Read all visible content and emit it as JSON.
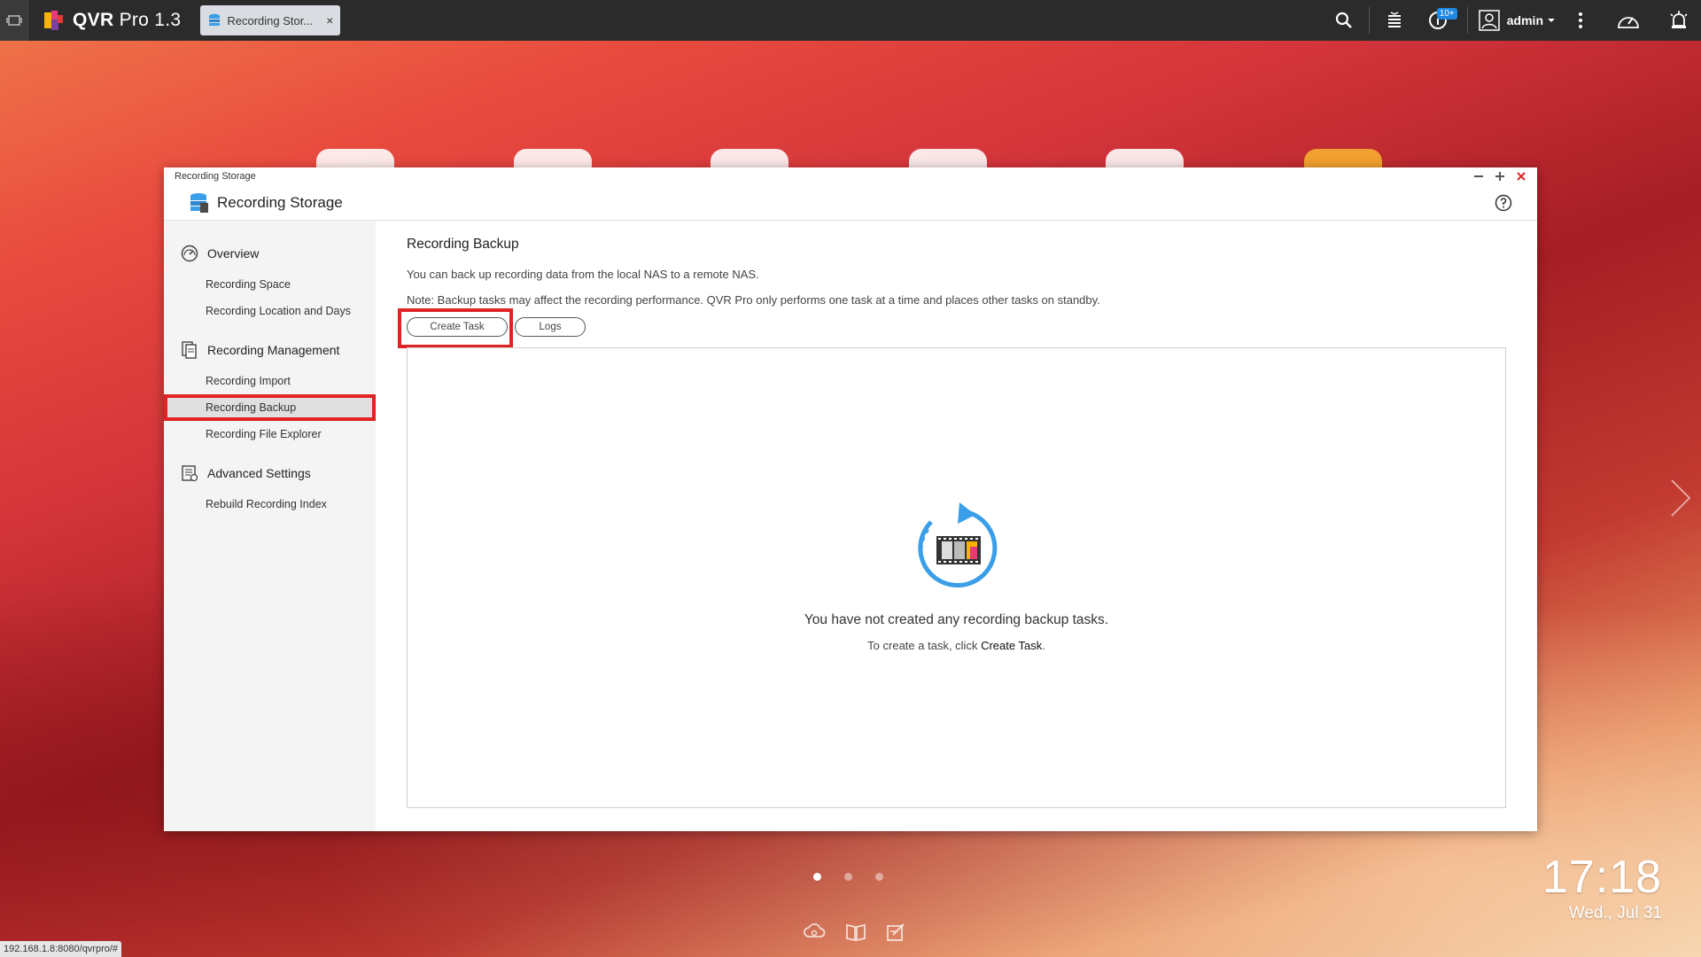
{
  "topbar": {
    "app_name": "QVR",
    "app_version": "Pro 1.3",
    "tab_label": "Recording Stor...",
    "tab_close": "×",
    "notification_badge": "10+",
    "user_name": "admin",
    "icons": [
      "desktop-icon",
      "search-icon",
      "tasks-icon",
      "notification-icon",
      "user-icon",
      "more-icon",
      "dashboard-icon",
      "alarm-icon"
    ]
  },
  "window": {
    "titlebar": "Recording Storage",
    "header_title": "Recording Storage",
    "controls": [
      "−",
      "+",
      "×"
    ]
  },
  "sidebar": {
    "groups": [
      {
        "label": "Overview",
        "icon": "gauge-icon",
        "items": [
          "Recording Space",
          "Recording Location and Days"
        ]
      },
      {
        "label": "Recording Management",
        "icon": "files-icon",
        "items": [
          "Recording Import",
          "Recording Backup",
          "Recording File Explorer"
        ]
      },
      {
        "label": "Advanced Settings",
        "icon": "settings-list-icon",
        "items": [
          "Rebuild Recording Index"
        ]
      }
    ],
    "active_item": "Recording Backup"
  },
  "content": {
    "title": "Recording Backup",
    "description": "You can back up recording data from the local NAS to a remote NAS.",
    "note": "Note: Backup tasks may affect the recording performance. QVR Pro only performs one task at a time and places other tasks on standby.",
    "buttons": {
      "create_task": "Create Task",
      "logs": "Logs"
    },
    "empty": {
      "title": "You have not created any recording backup tasks.",
      "sub_prefix": "To create a task, click ",
      "sub_link": "Create Task",
      "sub_suffix": "."
    }
  },
  "desktop": {
    "time": "17:18",
    "date": "Wed., Jul 31",
    "url": "192.168.1.8:8080/qvrpro/#",
    "page_dots": 3,
    "active_page": 1
  },
  "colors": {
    "accent_red": "#e02424",
    "topbar": "#2b2b2b",
    "icon_blue": "#3a9ee8"
  }
}
